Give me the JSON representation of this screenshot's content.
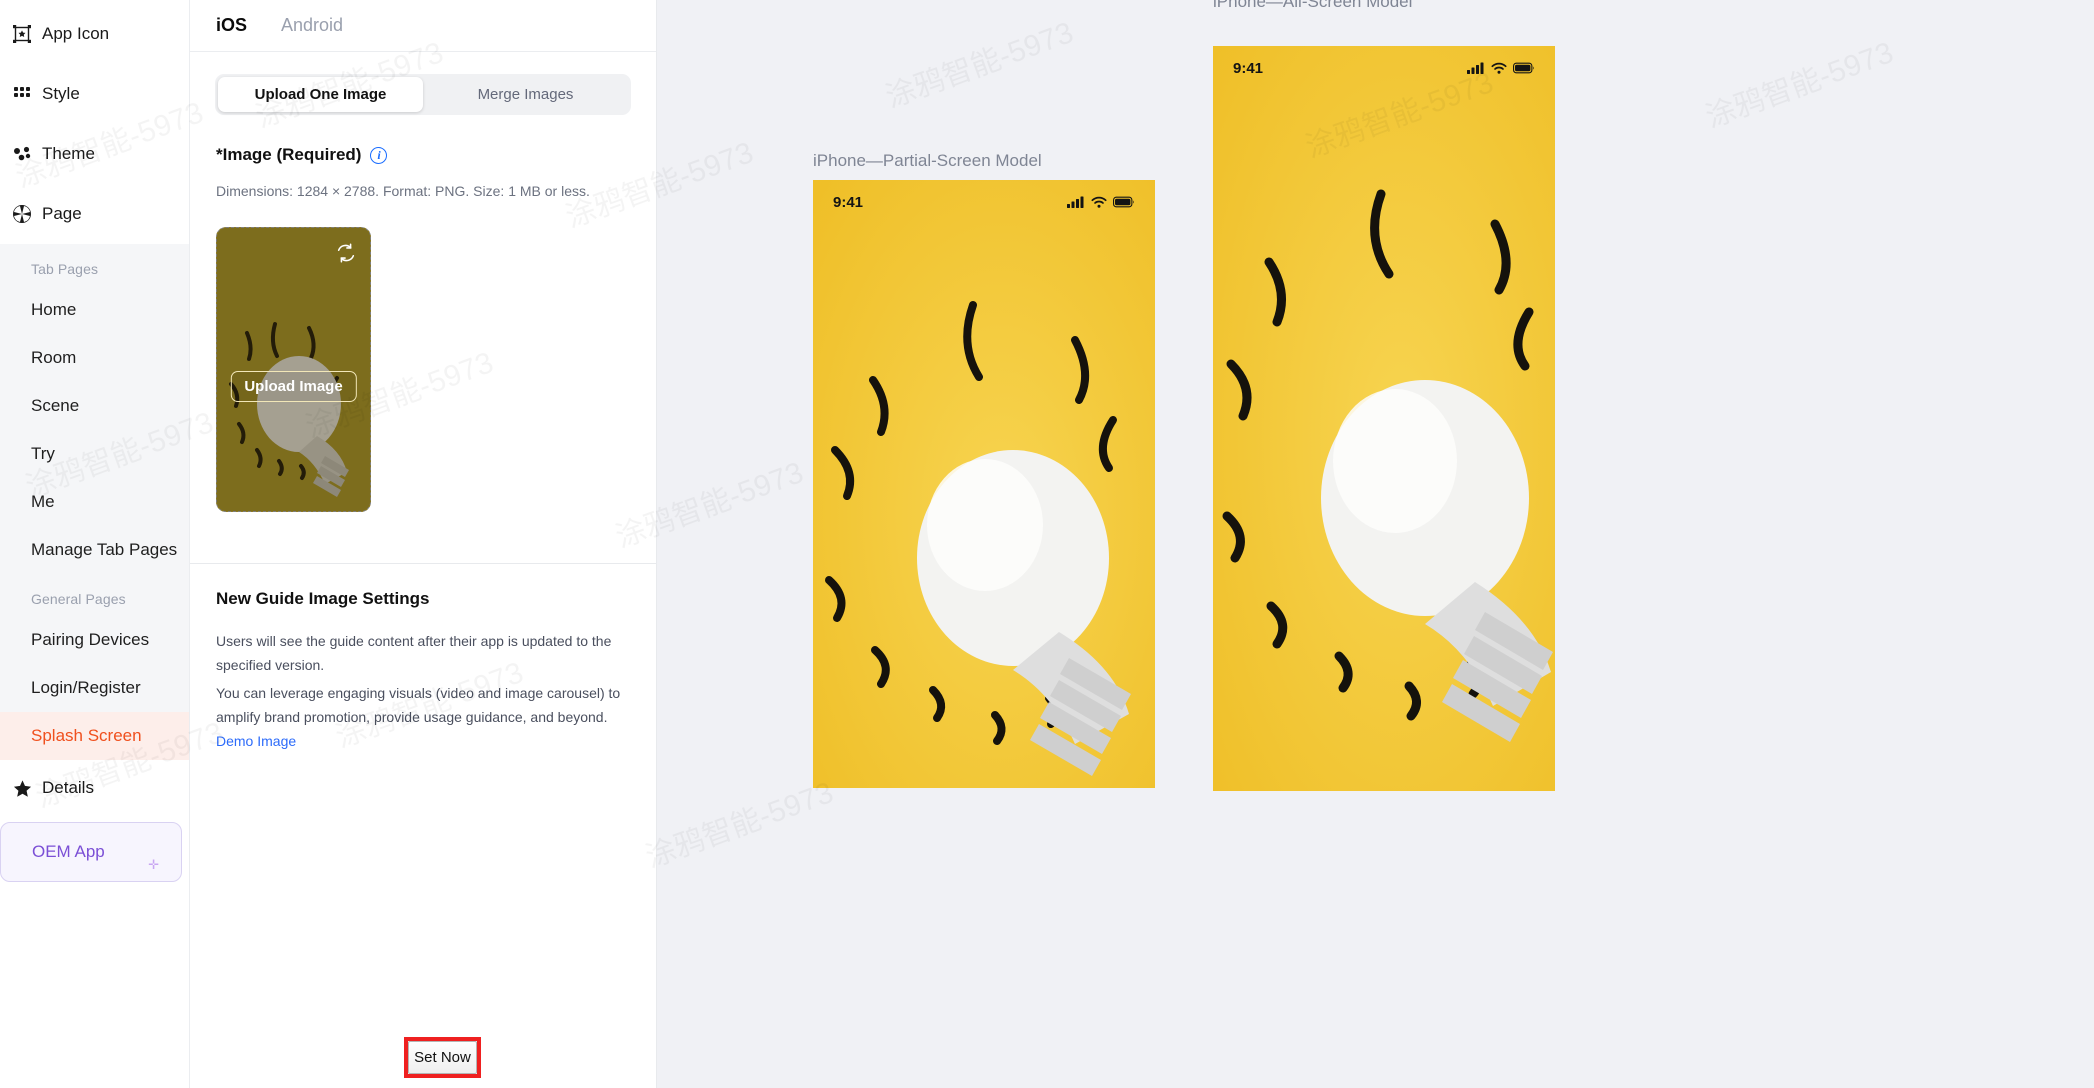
{
  "sidebar": {
    "top_items": [
      {
        "label": "App Icon",
        "icon": "app-icon-frame-icon"
      },
      {
        "label": "Style",
        "icon": "grid-dots-icon"
      },
      {
        "label": "Theme",
        "icon": "clover-dots-icon"
      },
      {
        "label": "Page",
        "icon": "aperture-icon"
      }
    ],
    "groups": [
      {
        "label": "Tab Pages",
        "items": [
          "Home",
          "Room",
          "Scene",
          "Try",
          "Me",
          "Manage Tab Pages"
        ]
      },
      {
        "label": "General Pages",
        "items": [
          "Pairing Devices",
          "Login/Register",
          "Splash Screen"
        ]
      }
    ],
    "active_item": "Splash Screen",
    "details_label": "Details",
    "details_icon": "star-icon",
    "oem_card_label": "OEM App",
    "accent_active": "#f0501e",
    "accent_active_bg": "#fdeeea",
    "oem_color": "#7b4fd6"
  },
  "middle": {
    "platform_tabs": [
      {
        "label": "iOS",
        "active": true
      },
      {
        "label": "Android",
        "active": false
      }
    ],
    "segmented": [
      {
        "label": "Upload One Image",
        "active": true
      },
      {
        "label": "Merge Images",
        "active": false
      }
    ],
    "image_field": {
      "label": "*Image (Required)",
      "info_icon": "info-circle-icon",
      "hint": "Dimensions: 1284 × 2788. Format: PNG. Size: 1 MB or less.",
      "upload_button": "Upload Image",
      "refresh_icon": "refresh-icon"
    },
    "guide": {
      "title": "New Guide Image Settings",
      "paragraph_1": "Users will see the guide content after their app is updated to the specified version.",
      "paragraph_2_before_link": "You can leverage engaging visuals (video and image carousel) to amplify brand promotion, provide usage guidance, and beyond. ",
      "link_text": "Demo Image",
      "set_now_button": "Set Now",
      "link_color": "#2c6bfa",
      "highlight_color": "#ef2020"
    }
  },
  "preview": {
    "phones": [
      {
        "title": "iPhone—Partial-Screen Model",
        "time": "9:41"
      },
      {
        "title": "iPhone—All-Screen Model",
        "time": "9:41"
      }
    ],
    "status_icons": [
      "signal-bars-icon",
      "wifi-icon",
      "battery-icon"
    ],
    "background": "#f0f1f5",
    "phone_bg": "#f2c832"
  },
  "watermark": {
    "text": "涂鸦智能-5973"
  }
}
